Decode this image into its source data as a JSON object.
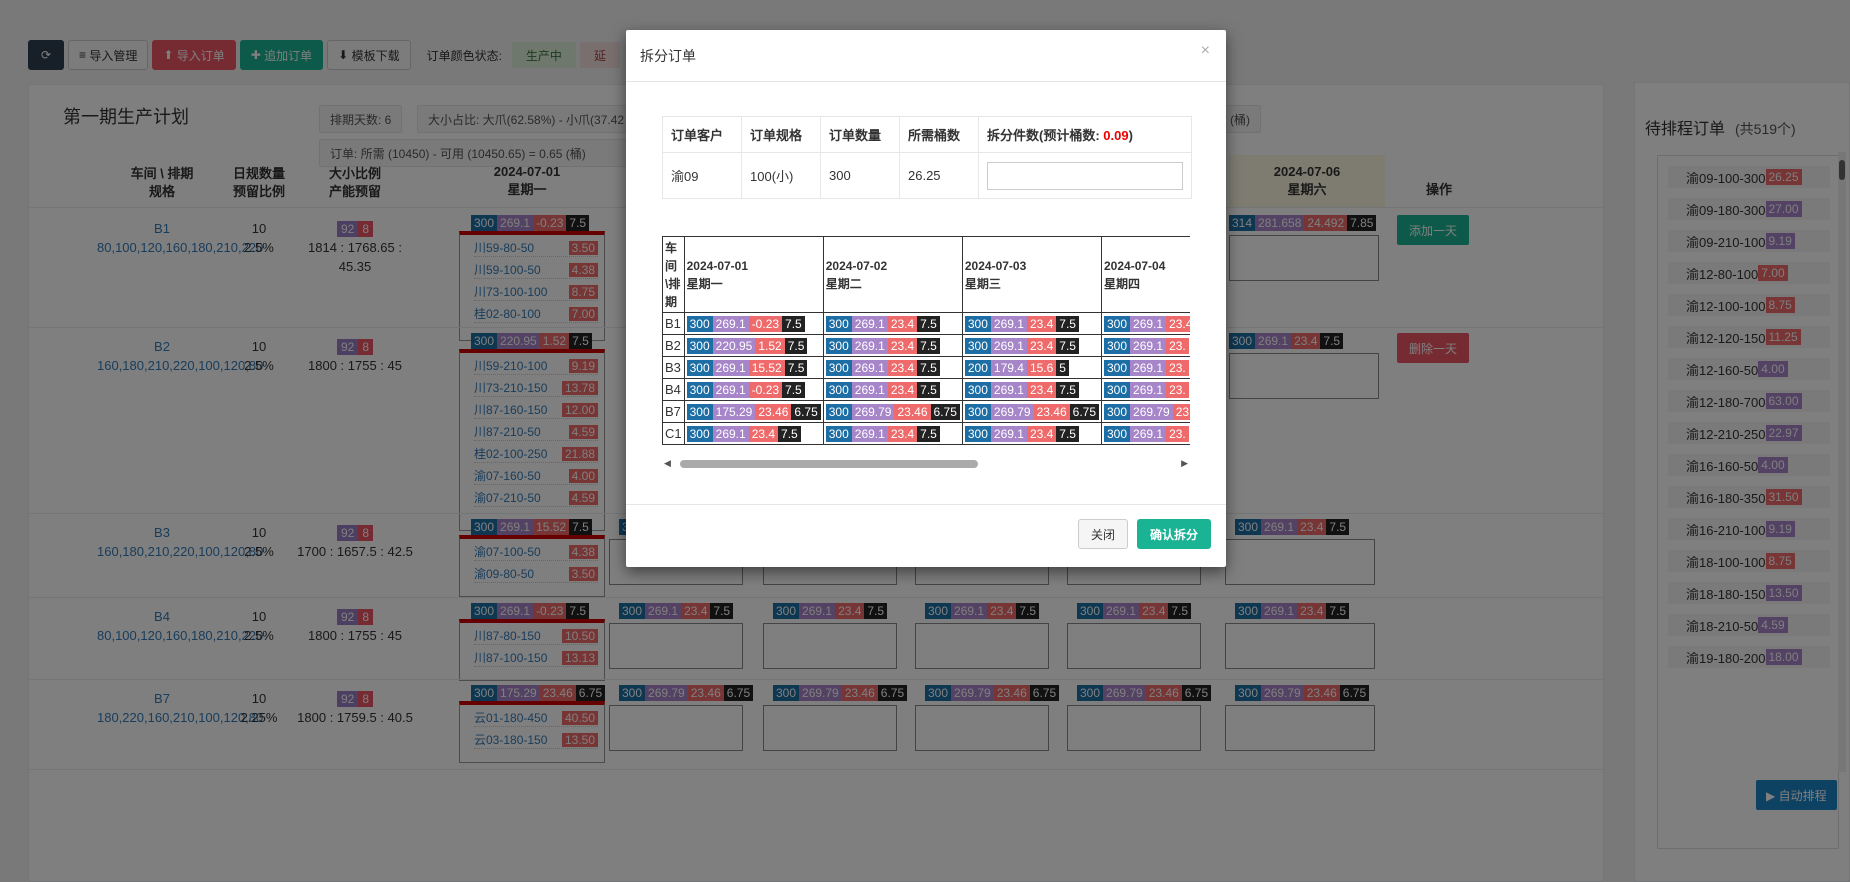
{
  "toolbar": {
    "import_manage": "导入管理",
    "import_order": "导入订单",
    "add_order": "追加订单",
    "template_download": "模板下载",
    "color_status_label": "订单颜色状态:",
    "status_producing": "生产中",
    "status_other": "延"
  },
  "plan": {
    "title": "第一期生产计划",
    "info_days": "排期天数: 6",
    "info_ratio": "大小占比: 大爪(62.58%) - 小爪(37.42",
    "info_order": "订单: 所需 (10450) - 可用 (10450.65) = 0.65 (桶)",
    "info_tail": "(桶)",
    "headers": {
      "workshop": "车间 \\ 排期",
      "spec": "规格",
      "daily_qty": "日规数量",
      "reserve_ratio": "预留比例",
      "size_ratio": "大小比例",
      "capacity": "产能预留",
      "ops": "操作"
    },
    "dates": [
      {
        "date": "2024-07-01",
        "weekday": "星期一"
      },
      {
        "date": "2024-07-06",
        "weekday": "星期六"
      }
    ],
    "rows": [
      {
        "name": "B1",
        "specs": "80,100,120,160,180,210,220",
        "qty": "10",
        "pct": "2.5%",
        "p": "92",
        "r": "8",
        "cap": "1814 : 1768.65 : 45.35",
        "tag": [
          "300",
          "269.1",
          "-0.23",
          "7.5"
        ],
        "sat": [
          "314",
          "281.658",
          "24.492",
          "7.85"
        ],
        "op": "添加一天",
        "items": [
          [
            "川59-80-50",
            "3.50"
          ],
          [
            "川59-100-50",
            "4.38"
          ],
          [
            "川73-100-100",
            "8.75"
          ],
          [
            "桂02-80-100",
            "7.00"
          ]
        ]
      },
      {
        "name": "B2",
        "specs": "160,180,210,220,100,120,80",
        "qty": "10",
        "pct": "2.5%",
        "p": "92",
        "r": "8",
        "cap": "1800 : 1755 : 45",
        "tag": [
          "300",
          "220.95",
          "1.52",
          "7.5"
        ],
        "sat": [
          "300",
          "269.1",
          "23.4",
          "7.5"
        ],
        "op": "删除一天",
        "items": [
          [
            "川59-210-100",
            "9.19"
          ],
          [
            "川73-210-150",
            "13.78"
          ],
          [
            "川87-160-150",
            "12.00"
          ],
          [
            "川87-210-50",
            "4.59"
          ],
          [
            "桂02-100-250",
            "21.88"
          ],
          [
            "渝07-160-50",
            "4.00"
          ],
          [
            "渝07-210-50",
            "4.59"
          ]
        ]
      },
      {
        "name": "B3",
        "specs": "160,180,210,220,100,120,80",
        "qty": "10",
        "pct": "2.5%",
        "p": "92",
        "r": "8",
        "cap": "1700 : 1657.5 : 42.5",
        "tag": [
          "300",
          "269.1",
          "15.52",
          "7.5"
        ],
        "days": [
          [
            "300",
            "269.1",
            "23.4",
            "7.5"
          ],
          [
            "200",
            "179.4",
            "15.6",
            "5"
          ],
          [
            "300",
            "269.1",
            "23.4",
            "7.5"
          ],
          [
            "300",
            "269.1",
            "23.4",
            "7.5"
          ],
          [
            "300",
            "269.1",
            "23.4",
            "7.5"
          ]
        ],
        "items": [
          [
            "渝07-100-50",
            "4.38"
          ],
          [
            "渝09-80-50",
            "3.50"
          ]
        ]
      },
      {
        "name": "B4",
        "specs": "80,100,120,160,180,210,220",
        "qty": "10",
        "pct": "2.5%",
        "p": "92",
        "r": "8",
        "cap": "1800 : 1755 : 45",
        "tag": [
          "300",
          "269.1",
          "-0.23",
          "7.5"
        ],
        "days": [
          [
            "300",
            "269.1",
            "23.4",
            "7.5"
          ],
          [
            "300",
            "269.1",
            "23.4",
            "7.5"
          ],
          [
            "300",
            "269.1",
            "23.4",
            "7.5"
          ],
          [
            "300",
            "269.1",
            "23.4",
            "7.5"
          ],
          [
            "300",
            "269.1",
            "23.4",
            "7.5"
          ]
        ],
        "items": [
          [
            "川87-80-150",
            "10.50"
          ],
          [
            "川87-100-150",
            "13.13"
          ]
        ]
      },
      {
        "name": "B7",
        "specs": "180,220,160,210,100,120,80",
        "qty": "10",
        "pct": "2.25%",
        "p": "92",
        "r": "8",
        "cap": "1800 : 1759.5 : 40.5",
        "tag": [
          "300",
          "175.29",
          "23.46",
          "6.75"
        ],
        "days": [
          [
            "300",
            "269.79",
            "23.46",
            "6.75"
          ],
          [
            "300",
            "269.79",
            "23.46",
            "6.75"
          ],
          [
            "300",
            "269.79",
            "23.46",
            "6.75"
          ],
          [
            "300",
            "269.79",
            "23.46",
            "6.75"
          ],
          [
            "300",
            "269.79",
            "23.46",
            "6.75"
          ]
        ],
        "items": [
          [
            "云01-180-450",
            "40.50"
          ],
          [
            "云03-180-150",
            "13.50"
          ]
        ]
      }
    ]
  },
  "side": {
    "title": "待排程订单",
    "count": "(共519个)",
    "items": [
      {
        "n": "渝09-100-300",
        "v": "26.25",
        "c": "r"
      },
      {
        "n": "渝09-180-300",
        "v": "27.00",
        "c": "p"
      },
      {
        "n": "渝09-210-100",
        "v": "9.19",
        "c": "p"
      },
      {
        "n": "渝12-80-100",
        "v": "7.00",
        "c": "r"
      },
      {
        "n": "渝12-100-100",
        "v": "8.75",
        "c": "r"
      },
      {
        "n": "渝12-120-150",
        "v": "11.25",
        "c": "r"
      },
      {
        "n": "渝12-160-50",
        "v": "4.00",
        "c": "p"
      },
      {
        "n": "渝12-180-700",
        "v": "63.00",
        "c": "p"
      },
      {
        "n": "渝12-210-250",
        "v": "22.97",
        "c": "p"
      },
      {
        "n": "渝16-160-50",
        "v": "4.00",
        "c": "p"
      },
      {
        "n": "渝16-180-350",
        "v": "31.50",
        "c": "r"
      },
      {
        "n": "渝16-210-100",
        "v": "9.19",
        "c": "p"
      },
      {
        "n": "渝18-100-100",
        "v": "8.75",
        "c": "r"
      },
      {
        "n": "渝18-180-150",
        "v": "13.50",
        "c": "p"
      },
      {
        "n": "渝18-210-50",
        "v": "4.59",
        "c": "p"
      },
      {
        "n": "渝19-180-200",
        "v": "18.00",
        "c": "p"
      }
    ],
    "auto_button": "▶ 自动排程"
  },
  "modal": {
    "title": "拆分订单",
    "close_x": "×",
    "headers": {
      "customer": "订单客户",
      "spec": "订单规格",
      "qty": "订单数量",
      "barrels": "所需桶数",
      "split_prefix": "拆分件数(预计桶数: ",
      "split_value": "0.09",
      "split_suffix": ")"
    },
    "order": {
      "customer": "渝09",
      "spec": "100(小)",
      "qty": "300",
      "barrels": "26.25"
    },
    "split_input_value": "",
    "grid": {
      "corner": "车间\\排期",
      "dates": [
        {
          "date": "2024-07-01",
          "weekday": "星期一"
        },
        {
          "date": "2024-07-02",
          "weekday": "星期二"
        },
        {
          "date": "2024-07-03",
          "weekday": "星期三"
        },
        {
          "date": "2024-07-04",
          "weekday": "星期四"
        }
      ],
      "rows": [
        {
          "name": "B1",
          "cells": [
            [
              "300",
              "269.1",
              "-0.23",
              "7.5"
            ],
            [
              "300",
              "269.1",
              "23.4",
              "7.5"
            ],
            [
              "300",
              "269.1",
              "23.4",
              "7.5"
            ],
            [
              "300",
              "269.1",
              "23.4",
              ""
            ]
          ]
        },
        {
          "name": "B2",
          "cells": [
            [
              "300",
              "220.95",
              "1.52",
              "7.5"
            ],
            [
              "300",
              "269.1",
              "23.4",
              "7.5"
            ],
            [
              "300",
              "269.1",
              "23.4",
              "7.5"
            ],
            [
              "300",
              "269.1",
              "23.",
              ""
            ]
          ]
        },
        {
          "name": "B3",
          "cells": [
            [
              "300",
              "269.1",
              "15.52",
              "7.5"
            ],
            [
              "300",
              "269.1",
              "23.4",
              "7.5"
            ],
            [
              "200",
              "179.4",
              "15.6",
              "5"
            ],
            [
              "300",
              "269.1",
              "23.",
              ""
            ]
          ]
        },
        {
          "name": "B4",
          "cells": [
            [
              "300",
              "269.1",
              "-0.23",
              "7.5"
            ],
            [
              "300",
              "269.1",
              "23.4",
              "7.5"
            ],
            [
              "300",
              "269.1",
              "23.4",
              "7.5"
            ],
            [
              "300",
              "269.1",
              "23.",
              ""
            ]
          ]
        },
        {
          "name": "B7",
          "cells": [
            [
              "300",
              "175.29",
              "23.46",
              "6.75"
            ],
            [
              "300",
              "269.79",
              "23.46",
              "6.75"
            ],
            [
              "300",
              "269.79",
              "23.46",
              "6.75"
            ],
            [
              "300",
              "269.79",
              "23",
              ""
            ]
          ]
        },
        {
          "name": "C1",
          "cells": [
            [
              "300",
              "269.1",
              "23.4",
              "7.5"
            ],
            [
              "300",
              "269.1",
              "23.4",
              "7.5"
            ],
            [
              "300",
              "269.1",
              "23.4",
              "7.5"
            ],
            [
              "300",
              "269.1",
              "23.",
              ""
            ]
          ]
        }
      ]
    },
    "close_button": "关闭",
    "confirm_button": "确认拆分"
  },
  "colors": {
    "blue": "#1c6ea4",
    "purple": "#a685c9",
    "red": "#ef6a6a",
    "black": "#222222",
    "green": "#1ab394"
  }
}
